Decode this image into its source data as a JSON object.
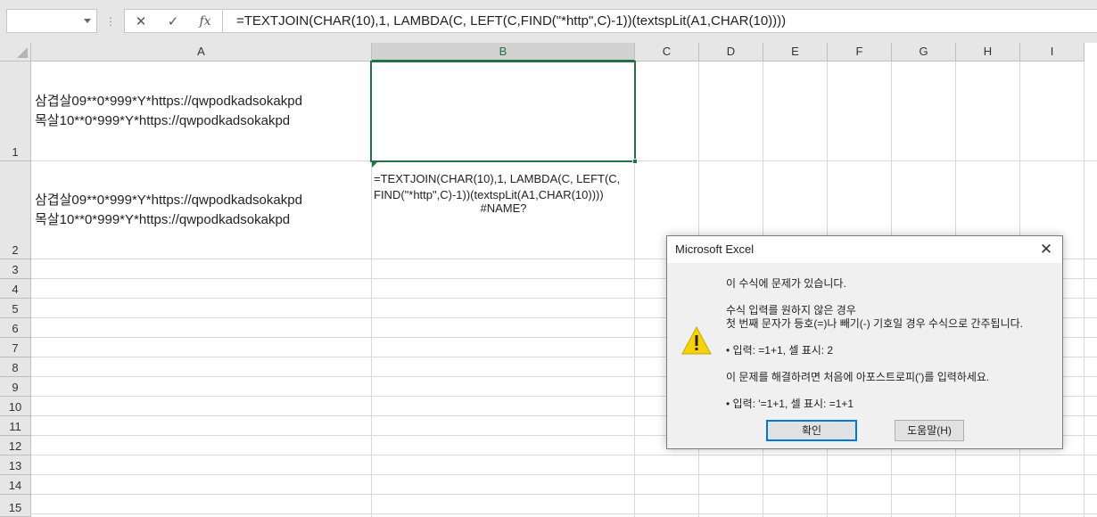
{
  "formula_bar": {
    "name_box_value": "",
    "formula": "=TEXTJOIN(CHAR(10),1, LAMBDA(C, LEFT(C,FIND(\"*http\",C)-1))(textspLit(A1,CHAR(10))))",
    "cancel_glyph": "✕",
    "enter_glyph": "✓",
    "fx_glyph": "fx",
    "dots_glyph": "⋮"
  },
  "columns": [
    "A",
    "B",
    "C",
    "D",
    "E",
    "F",
    "G",
    "H",
    "I"
  ],
  "selected_column": "B",
  "rows": [
    "1",
    "2",
    "3",
    "4",
    "5",
    "6",
    "7",
    "8",
    "9",
    "10",
    "11",
    "12",
    "13",
    "14",
    "15"
  ],
  "cells": {
    "A1": [
      "삼겹살09**0*999*Y*https://qwpodkadsokakpd",
      "목살10**0*999*Y*https://qwpodkadsokakpd"
    ],
    "A2": [
      "삼겹살09**0*999*Y*https://qwpodkadsokakpd",
      "목살10**0*999*Y*https://qwpodkadsokakpd"
    ],
    "B1": [
      "=TEXTJOIN(CHAR(10),1, LAMBDA(C, LEFT(C,",
      "FIND(\"*http\",C)-1))(textspLit(A1,CHAR(10))))"
    ],
    "B2": "#NAME?"
  },
  "dialog": {
    "title": "Microsoft Excel",
    "close_glyph": "✕",
    "icon": "warning-icon",
    "lines": [
      "이 수식에 문제가 있습니다.",
      "수식 입력를 원하지 않은 경우",
      "첫 번째 문자가 등호(=)나 빼기(-) 기호일 경우 수식으로 간주됩니다.",
      "• 입력:   =1+1, 셀 표시:   2",
      "이 문제를 해결하려면 처음에 아포스트로피(')를 입력하세요.",
      "• 입력:   '=1+1, 셀 표시:   =1+1"
    ],
    "ok_label": "확인",
    "help_label": "도움말(H)"
  },
  "colors": {
    "accent": "#217346",
    "dialog_focus": "#0078d7",
    "warning": "#f5d20a"
  }
}
